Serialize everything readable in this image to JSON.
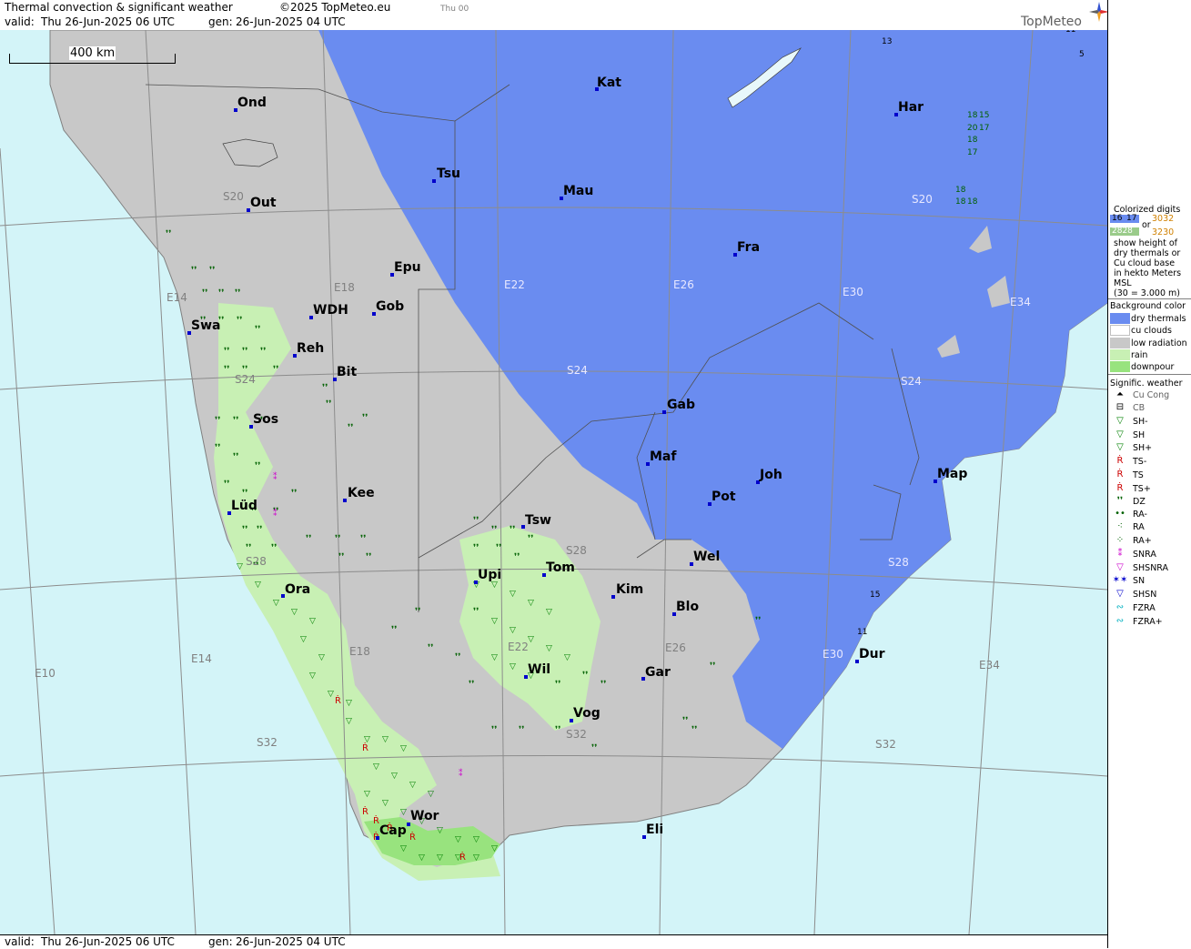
{
  "header": {
    "title": "Thermal convection & significant weather",
    "copyright": "©2025 TopMeteo.eu",
    "tab_label": "Thu 00",
    "valid_label": "valid:",
    "valid_value": "Thu   26-Jun-2025  06 UTC",
    "gen_label": "gen:",
    "gen_value": "26-Jun-2025 04 UTC",
    "logo": "TopMeteo"
  },
  "footer": {
    "valid_label": "valid:",
    "valid_value": "Thu   26-Jun-2025  06 UTC",
    "gen_label": "gen:",
    "gen_value": "26-Jun-2025 04 UTC"
  },
  "scale": {
    "label": "400 km"
  },
  "map": {
    "colors": {
      "sea": "#d3f4f8",
      "low_radiation": "#c8c8c8",
      "dry_thermals": "#6a8cf0",
      "rain": "#c8f0b4",
      "downpour": "#98e37e",
      "grid": "#8c8c8c",
      "city_dot": "#0000cc"
    },
    "cities": [
      {
        "name": "Ond"
      },
      {
        "name": "Out"
      },
      {
        "name": "Tsu"
      },
      {
        "name": "Kat"
      },
      {
        "name": "Mau"
      },
      {
        "name": "Har"
      },
      {
        "name": "Fra"
      },
      {
        "name": "Epu"
      },
      {
        "name": "WDH"
      },
      {
        "name": "Gob"
      },
      {
        "name": "Swa"
      },
      {
        "name": "Reh"
      },
      {
        "name": "Bit"
      },
      {
        "name": "Sos"
      },
      {
        "name": "Gab"
      },
      {
        "name": "Maf"
      },
      {
        "name": "Joh"
      },
      {
        "name": "Map"
      },
      {
        "name": "Kee"
      },
      {
        "name": "Lüd"
      },
      {
        "name": "Pot"
      },
      {
        "name": "Tsw"
      },
      {
        "name": "Wel"
      },
      {
        "name": "Upi"
      },
      {
        "name": "Tom"
      },
      {
        "name": "Ora"
      },
      {
        "name": "Kim"
      },
      {
        "name": "Blo"
      },
      {
        "name": "Wil"
      },
      {
        "name": "Gar"
      },
      {
        "name": "Dur"
      },
      {
        "name": "Vog"
      },
      {
        "name": "Wor"
      },
      {
        "name": "Cap"
      },
      {
        "name": "Eli"
      }
    ],
    "grid_labels": [
      "S20",
      "S20",
      "E14",
      "E18",
      "E22",
      "E26",
      "E30",
      "E34",
      "S24",
      "S24",
      "S24",
      "S28",
      "S28",
      "S28",
      "E10",
      "E14",
      "E18",
      "E22",
      "E26",
      "E30",
      "E34",
      "S32",
      "S32",
      "S32"
    ],
    "digits": [
      "13",
      "18",
      "15",
      "20",
      "17",
      "18",
      "17",
      "18",
      "18",
      "18",
      "15",
      "11",
      "11",
      "5"
    ]
  },
  "legend": {
    "colorized_title": "Colorized digits",
    "sample_a1": "16",
    "sample_a2": "17",
    "sample_or": "or",
    "sample_b1": "3032",
    "sample_c1": "2828",
    "sample_b2": "3230",
    "desc": [
      "show height of",
      "dry thermals or",
      "Cu cloud base",
      "in hekto Meters",
      "MSL",
      "(30 = 3.000 m)"
    ],
    "bg_title": "Background color",
    "bg_items": [
      {
        "label": "dry thermals",
        "color": "#6a8cf0"
      },
      {
        "label": "cu clouds",
        "color": "#ffffff"
      },
      {
        "label": "low radiation",
        "color": "#c8c8c8"
      },
      {
        "label": "rain",
        "color": "#c8f0b4"
      },
      {
        "label": "downpour",
        "color": "#98e37e"
      }
    ],
    "sig_title": "Signific. weather",
    "sig_items": [
      {
        "label": "Cu Cong",
        "icon": "cu-cong-icon",
        "glyph": "⏶",
        "color": "#000000"
      },
      {
        "label": "CB",
        "icon": "cb-icon",
        "glyph": "⊟",
        "color": "#000000"
      },
      {
        "label": "SH-",
        "icon": "shower-light-icon",
        "glyph": "▽",
        "color": "#008000"
      },
      {
        "label": "SH",
        "icon": "shower-icon",
        "glyph": "▽",
        "color": "#008000"
      },
      {
        "label": "SH+",
        "icon": "shower-heavy-icon",
        "glyph": "▽",
        "color": "#008000"
      },
      {
        "label": "TS-",
        "icon": "thunderstorm-light-icon",
        "glyph": "Ṙ",
        "color": "#cc0000"
      },
      {
        "label": "TS",
        "icon": "thunderstorm-icon",
        "glyph": "Ṙ",
        "color": "#cc0000"
      },
      {
        "label": "TS+",
        "icon": "thunderstorm-heavy-icon",
        "glyph": "Ṙ",
        "color": "#cc0000"
      },
      {
        "label": "DZ",
        "icon": "drizzle-icon",
        "glyph": "❜❜",
        "color": "#006000"
      },
      {
        "label": "RA-",
        "icon": "rain-light-icon",
        "glyph": "••",
        "color": "#006000"
      },
      {
        "label": "RA",
        "icon": "rain-icon",
        "glyph": "⁖",
        "color": "#006000"
      },
      {
        "label": "RA+",
        "icon": "rain-heavy-icon",
        "glyph": "⁘",
        "color": "#006000"
      },
      {
        "label": "SNRA",
        "icon": "snow-rain-icon",
        "glyph": "⁑",
        "color": "#cc00cc"
      },
      {
        "label": "SHSNRA",
        "icon": "snow-rain-shower-icon",
        "glyph": "▽",
        "color": "#cc00cc"
      },
      {
        "label": "SN",
        "icon": "snow-icon",
        "glyph": "✶✶",
        "color": "#0000cc"
      },
      {
        "label": "SHSN",
        "icon": "snow-shower-icon",
        "glyph": "▽",
        "color": "#0000cc"
      },
      {
        "label": "FZRA",
        "icon": "freezing-rain-icon",
        "glyph": "∾",
        "color": "#00b0c0"
      },
      {
        "label": "FZRA+",
        "icon": "freezing-rain-heavy-icon",
        "glyph": "∾",
        "color": "#00b0c0"
      }
    ]
  }
}
